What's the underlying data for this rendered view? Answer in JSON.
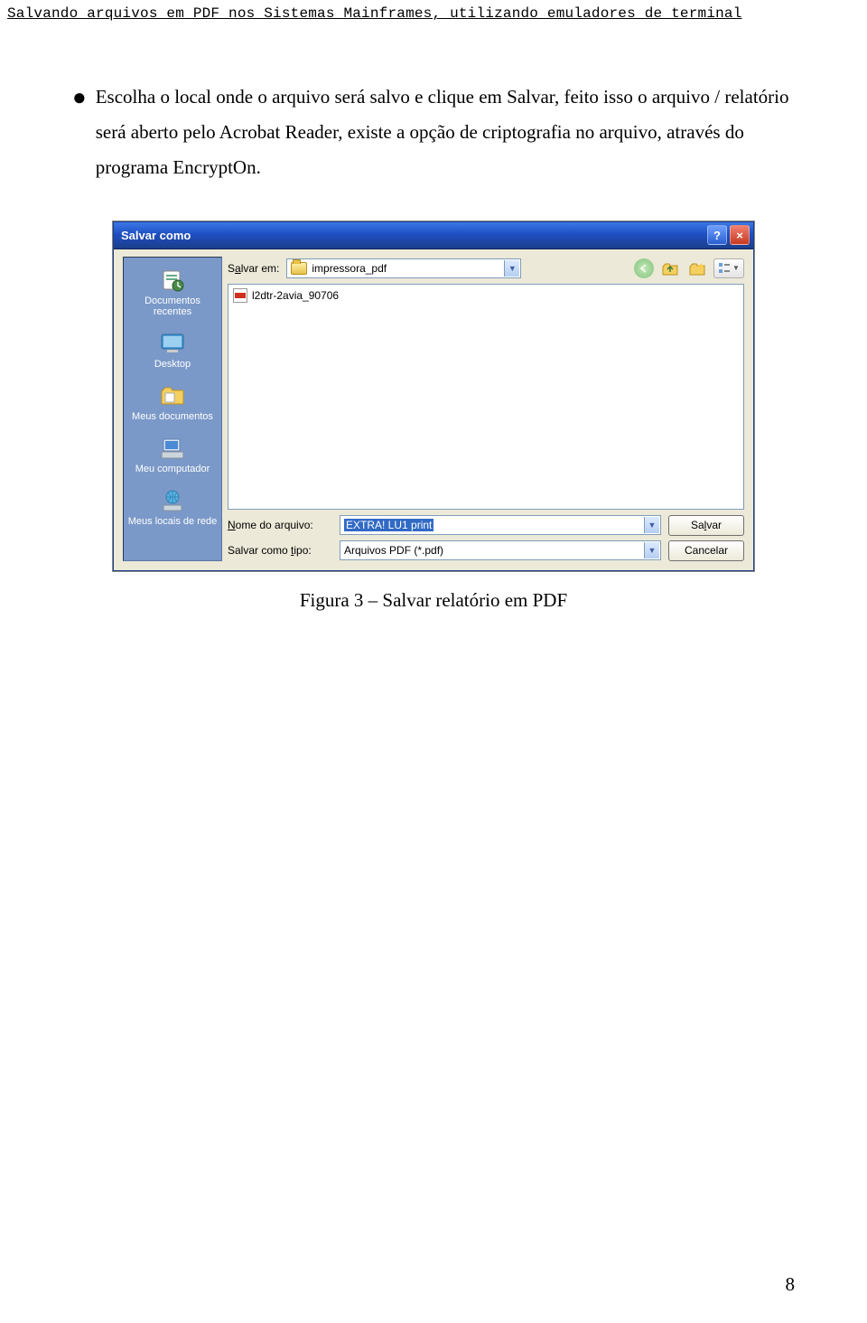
{
  "header": "Salvando arquivos em PDF nos Sistemas Mainframes, utilizando emuladores de terminal",
  "bullet_text": "Escolha o local onde o arquivo será salvo e clique em Salvar, feito isso o arquivo / relatório será aberto pelo Acrobat Reader, existe a opção de criptografia no arquivo, através do programa EncryptOn.",
  "dialog": {
    "title": "Salvar como",
    "help": "?",
    "close": "×",
    "save_in_label_pre": "S",
    "save_in_label_ul": "a",
    "save_in_label_post": "lvar em:",
    "save_in_value": "impressora_pdf",
    "places": {
      "recent": "Documentos recentes",
      "desktop": "Desktop",
      "mydocs": "Meus documentos",
      "mycomputer": "Meu computador",
      "mynetwork": "Meus locais de rede"
    },
    "file_item": "l2dtr-2avia_90706",
    "filename_label_ul": "N",
    "filename_label_post": "ome do arquivo:",
    "filename_value": "EXTRA! LU1 print",
    "filetype_label_pre": "Salvar como ",
    "filetype_label_ul": "t",
    "filetype_label_post": "ipo:",
    "filetype_value": "Arquivos PDF (*.pdf)",
    "save_btn_pre": "Sa",
    "save_btn_ul": "l",
    "save_btn_post": "var",
    "cancel_btn": "Cancelar"
  },
  "caption": "Figura 3 – Salvar relatório em PDF",
  "page_number": "8"
}
